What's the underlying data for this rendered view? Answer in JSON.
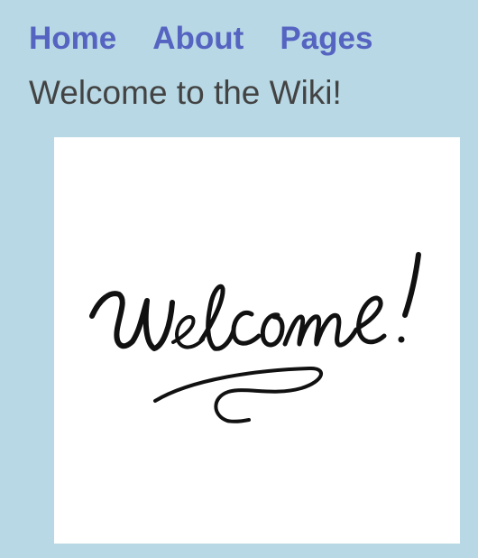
{
  "nav": {
    "home_label": "Home",
    "about_label": "About",
    "pages_label": "Pages"
  },
  "main": {
    "heading": "Welcome to the Wiki!",
    "image": {
      "lettering": "Welcome!"
    }
  },
  "colors": {
    "background": "#b7d8e4",
    "nav_link": "#5563c1",
    "heading_text": "#434343",
    "image_background": "#ffffff",
    "ink": "#111111"
  }
}
